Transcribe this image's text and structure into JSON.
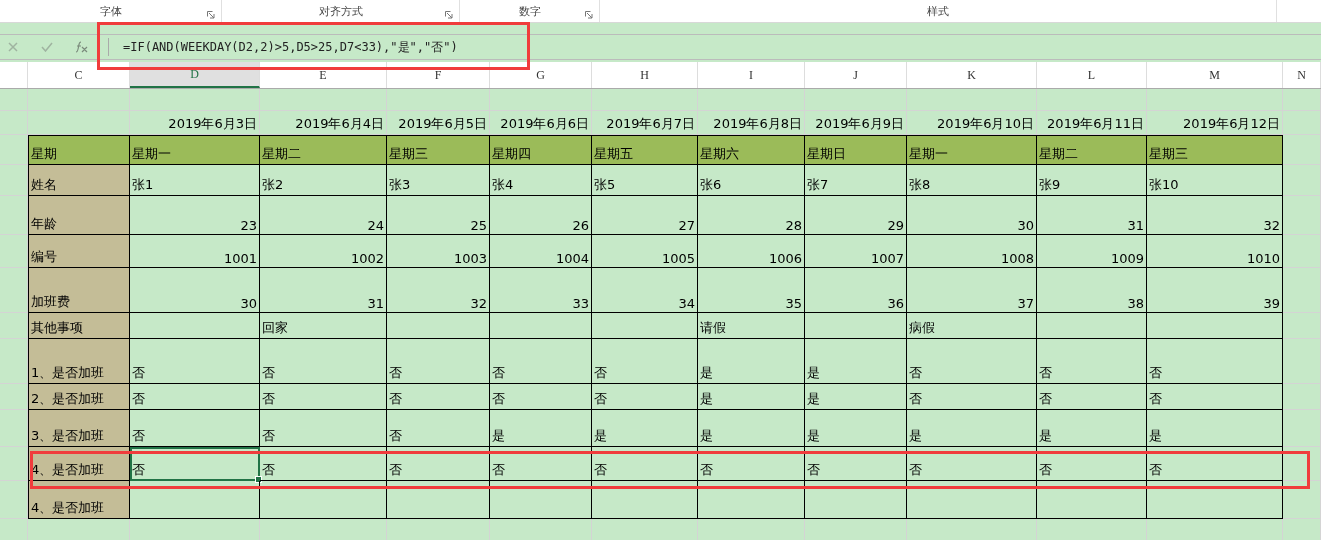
{
  "ribbon_groups": [
    {
      "label": "字体",
      "launcher": true
    },
    {
      "label": "对齐方式",
      "launcher": true
    },
    {
      "label": "数字",
      "launcher": true
    },
    {
      "label": "样式",
      "launcher": false
    }
  ],
  "formula_bar": {
    "formula": "=IF(AND(WEEKDAY(D2,2)>5,D5>25,D7<33),\"是\",\"否\")"
  },
  "column_headers": [
    {
      "label": "C",
      "selected": false
    },
    {
      "label": "D",
      "selected": true
    },
    {
      "label": "E",
      "selected": false
    },
    {
      "label": "F",
      "selected": false
    },
    {
      "label": "G",
      "selected": false
    },
    {
      "label": "H",
      "selected": false
    },
    {
      "label": "I",
      "selected": false
    },
    {
      "label": "J",
      "selected": false
    },
    {
      "label": "K",
      "selected": false
    },
    {
      "label": "L",
      "selected": false
    },
    {
      "label": "M",
      "selected": false
    },
    {
      "label": "N",
      "selected": false
    }
  ],
  "dates": [
    "2019年6月3日",
    "2019年6月4日",
    "2019年6月5日",
    "2019年6月6日",
    "2019年6月7日",
    "2019年6月8日",
    "2019年6月9日",
    "2019年6月10日",
    "2019年6月11日",
    "2019年6月12日"
  ],
  "rows": [
    {
      "label": "星期",
      "kind": "header",
      "cells": [
        {
          "text": "星期一",
          "selected": false
        },
        {
          "text": "星期二",
          "selected": false
        },
        {
          "text": "星期三",
          "selected": false
        },
        {
          "text": "星期四",
          "selected": false
        },
        {
          "text": "星期五",
          "selected": false
        },
        {
          "text": "星期六",
          "selected": false
        },
        {
          "text": "星期日",
          "selected": false
        },
        {
          "text": "星期一",
          "selected": false
        },
        {
          "text": "星期二",
          "selected": false
        },
        {
          "text": "星期三",
          "selected": false
        }
      ]
    },
    {
      "label": "姓名",
      "kind": "text",
      "cells": [
        {
          "text": "张1",
          "selected": false
        },
        {
          "text": "张2",
          "selected": false
        },
        {
          "text": "张3",
          "selected": false
        },
        {
          "text": "张4",
          "selected": false
        },
        {
          "text": "张5",
          "selected": false
        },
        {
          "text": "张6",
          "selected": false
        },
        {
          "text": "张7",
          "selected": false
        },
        {
          "text": "张8",
          "selected": false
        },
        {
          "text": "张9",
          "selected": false
        },
        {
          "text": "张10",
          "selected": false
        }
      ]
    },
    {
      "label": "年龄",
      "kind": "number",
      "cells": [
        {
          "text": "23",
          "selected": false
        },
        {
          "text": "24",
          "selected": false
        },
        {
          "text": "25",
          "selected": false
        },
        {
          "text": "26",
          "selected": false
        },
        {
          "text": "27",
          "selected": false
        },
        {
          "text": "28",
          "selected": false
        },
        {
          "text": "29",
          "selected": false
        },
        {
          "text": "30",
          "selected": false
        },
        {
          "text": "31",
          "selected": false
        },
        {
          "text": "32",
          "selected": false
        }
      ]
    },
    {
      "label": "编号",
      "kind": "number",
      "cells": [
        {
          "text": "1001",
          "selected": false
        },
        {
          "text": "1002",
          "selected": false
        },
        {
          "text": "1003",
          "selected": false
        },
        {
          "text": "1004",
          "selected": false
        },
        {
          "text": "1005",
          "selected": false
        },
        {
          "text": "1006",
          "selected": false
        },
        {
          "text": "1007",
          "selected": false
        },
        {
          "text": "1008",
          "selected": false
        },
        {
          "text": "1009",
          "selected": false
        },
        {
          "text": "1010",
          "selected": false
        }
      ]
    },
    {
      "label": "加班费",
      "kind": "number",
      "cells": [
        {
          "text": "30",
          "selected": false
        },
        {
          "text": "31",
          "selected": false
        },
        {
          "text": "32",
          "selected": false
        },
        {
          "text": "33",
          "selected": false
        },
        {
          "text": "34",
          "selected": false
        },
        {
          "text": "35",
          "selected": false
        },
        {
          "text": "36",
          "selected": false
        },
        {
          "text": "37",
          "selected": false
        },
        {
          "text": "38",
          "selected": false
        },
        {
          "text": "39",
          "selected": false
        }
      ]
    },
    {
      "label": "其他事项",
      "kind": "text",
      "cells": [
        {
          "selected": false
        },
        {
          "text": "回家",
          "selected": false
        },
        {
          "selected": false
        },
        {
          "selected": false
        },
        {
          "selected": false
        },
        {
          "text": "请假",
          "selected": false
        },
        {
          "selected": false
        },
        {
          "text": "病假",
          "selected": false
        },
        {
          "selected": false
        },
        {
          "selected": false
        }
      ]
    },
    {
      "label": "1、是否加班",
      "kind": "text",
      "cells": [
        {
          "text": "否",
          "selected": false
        },
        {
          "text": "否",
          "selected": false
        },
        {
          "text": "否",
          "selected": false
        },
        {
          "text": "否",
          "selected": false
        },
        {
          "text": "否",
          "selected": false
        },
        {
          "text": "是",
          "selected": false
        },
        {
          "text": "是",
          "selected": false
        },
        {
          "text": "否",
          "selected": false
        },
        {
          "text": "否",
          "selected": false
        },
        {
          "text": "否",
          "selected": false
        }
      ]
    },
    {
      "label": "2、是否加班",
      "kind": "text",
      "cells": [
        {
          "text": "否",
          "selected": false
        },
        {
          "text": "否",
          "selected": false
        },
        {
          "text": "否",
          "selected": false
        },
        {
          "text": "否",
          "selected": false
        },
        {
          "text": "否",
          "selected": false
        },
        {
          "text": "是",
          "selected": false
        },
        {
          "text": "是",
          "selected": false
        },
        {
          "text": "否",
          "selected": false
        },
        {
          "text": "否",
          "selected": false
        },
        {
          "text": "否",
          "selected": false
        }
      ]
    },
    {
      "label": "3、是否加班",
      "kind": "text",
      "cells": [
        {
          "text": "否",
          "selected": false
        },
        {
          "text": "否",
          "selected": false
        },
        {
          "text": "否",
          "selected": false
        },
        {
          "text": "是",
          "selected": false
        },
        {
          "text": "是",
          "selected": false
        },
        {
          "text": "是",
          "selected": false
        },
        {
          "text": "是",
          "selected": false
        },
        {
          "text": "是",
          "selected": false
        },
        {
          "text": "是",
          "selected": false
        },
        {
          "text": "是",
          "selected": false
        }
      ]
    },
    {
      "label": "4、是否加班",
      "kind": "text",
      "cells": [
        {
          "text": "否",
          "selected": true
        },
        {
          "text": "否",
          "selected": false
        },
        {
          "text": "否",
          "selected": false
        },
        {
          "text": "否",
          "selected": false
        },
        {
          "text": "否",
          "selected": false
        },
        {
          "text": "否",
          "selected": false
        },
        {
          "text": "否",
          "selected": false
        },
        {
          "text": "否",
          "selected": false
        },
        {
          "text": "否",
          "selected": false
        },
        {
          "text": "否",
          "selected": false
        }
      ]
    },
    {
      "label": "4、是否加班",
      "kind": "text",
      "cells": [
        {
          "selected": false
        },
        {
          "selected": false
        },
        {
          "selected": false
        },
        {
          "selected": false
        },
        {
          "selected": false
        },
        {
          "selected": false
        },
        {
          "selected": false
        },
        {
          "selected": false
        },
        {
          "selected": false
        },
        {
          "selected": false
        }
      ]
    }
  ],
  "highlights": {
    "formula_bar": true,
    "row": true
  }
}
